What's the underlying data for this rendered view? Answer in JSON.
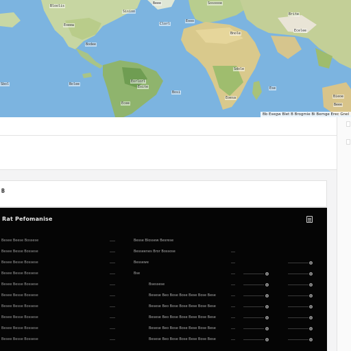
{
  "map": {
    "attribution": "Bb Esegw Blet B Brogmie Bi Bemge Erec Gnel",
    "labels": [
      "Eoeew",
      "Sisioo",
      "Clorl",
      "Beee",
      "Bloolis",
      "Bodee",
      "Eorlorl",
      "Bosi",
      "Ecee",
      "Sosoooe",
      "Bnole",
      "Sdole",
      "Ese",
      "Brite",
      "Ecelee",
      "Eoesa",
      "Sbol",
      "Eoite",
      "Bieoe",
      "Beee",
      "Bolee",
      "Eooo"
    ]
  },
  "card": {
    "glyph": "B"
  },
  "panel": {
    "title": "Rat Pefomanise",
    "rows": [
      {
        "code": "Besee Beese Bossese",
        "desc": "Besse Blossew Besrese",
        "mid": "",
        "small": "",
        "small2": ""
      },
      {
        "code": "Besee Besse Bossese",
        "desc": "Besseenes Bror Bossose",
        "mid": "",
        "small": "",
        "small2": ""
      },
      {
        "code": "Besee Besse Bossese",
        "desc": "Bessewe",
        "mid": "",
        "small": "",
        "small2": ""
      },
      {
        "code": "Besee Besse Bossese",
        "desc": "Bse",
        "mid": "",
        "small": "",
        "small2": ""
      },
      {
        "code": "Besee Besse Bossese",
        "desc": "Bsessese",
        "mid": "",
        "small": "",
        "small2": ""
      },
      {
        "code": "Besee Besse Bossese",
        "desc": "Besese Beo Bose Bose Bese Bose Bese",
        "mid": "",
        "small": "",
        "small2": ""
      },
      {
        "code": "Besee Besse Bossese",
        "desc": "Besese Beo Bose Bose Bese Bose Bese",
        "mid": "",
        "small": "",
        "small2": ""
      },
      {
        "code": "Besee Besse Bossese",
        "desc": "Besese Beo Bose Bose Bese Bose Bese",
        "mid": "",
        "small": "",
        "small2": ""
      },
      {
        "code": "Besee Besse Bossese",
        "desc": "Besese Beo Bose Bose Bese Bose Bese",
        "mid": "",
        "small": "",
        "small2": ""
      },
      {
        "code": "Besee Besse Bossese",
        "desc": "Besese Beo Bose Bose Bese Bose Bese",
        "mid": "",
        "small": "",
        "small2": ""
      }
    ]
  }
}
